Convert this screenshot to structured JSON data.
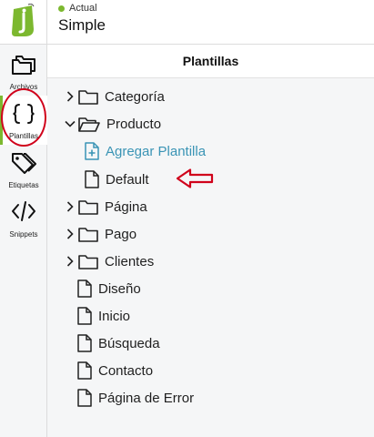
{
  "colors": {
    "brand_green": "#7cb82f",
    "status_green": "#7cb82f",
    "link_blue": "#3a94b5",
    "annotation_red": "#d0021b"
  },
  "header": {
    "status_label": "Actual",
    "theme_name": "Simple"
  },
  "rail": {
    "items": [
      {
        "label": "Archivos",
        "icon": "folders-icon"
      },
      {
        "label": "Plantillas",
        "icon": "curly-braces-icon"
      },
      {
        "label": "Etiquetas",
        "icon": "tags-icon"
      },
      {
        "label": "Snippets",
        "icon": "code-icon"
      }
    ],
    "active": "Plantillas"
  },
  "panel": {
    "title": "Plantillas",
    "tree": [
      {
        "label": "Categoría",
        "type": "folder",
        "expanded": false
      },
      {
        "label": "Producto",
        "type": "folder",
        "expanded": true
      },
      {
        "label": "Agregar Plantilla",
        "type": "add-file"
      },
      {
        "label": "Default",
        "type": "file"
      },
      {
        "label": "Página",
        "type": "folder",
        "expanded": false
      },
      {
        "label": "Pago",
        "type": "folder",
        "expanded": false
      },
      {
        "label": "Clientes",
        "type": "folder",
        "expanded": false
      },
      {
        "label": "Diseño",
        "type": "file"
      },
      {
        "label": "Inicio",
        "type": "file"
      },
      {
        "label": "Búsqueda",
        "type": "file"
      },
      {
        "label": "Contacto",
        "type": "file"
      },
      {
        "label": "Página de Error",
        "type": "file"
      }
    ]
  }
}
